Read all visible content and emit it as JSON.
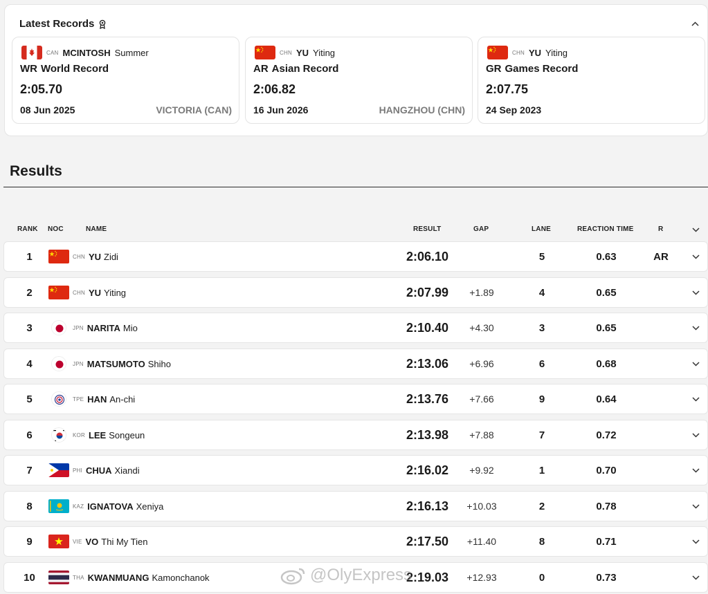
{
  "records": {
    "title": "Latest Records",
    "cards": [
      {
        "noc": "CAN",
        "last": "MCINTOSH",
        "first": "Summer",
        "abbr": "WR",
        "type": "World Record",
        "time": "2:05.70",
        "date": "08 Jun 2025",
        "location": "VICTORIA (CAN)"
      },
      {
        "noc": "CHN",
        "last": "YU",
        "first": "Yiting",
        "abbr": "AR",
        "type": "Asian Record",
        "time": "2:06.82",
        "date": "16 Jun 2026",
        "location": "HANGZHOU (CHN)"
      },
      {
        "noc": "CHN",
        "last": "YU",
        "first": "Yiting",
        "abbr": "GR",
        "type": "Games Record",
        "time": "2:07.75",
        "date": "24 Sep 2023",
        "location": ""
      }
    ]
  },
  "results": {
    "heading": "Results",
    "columns": {
      "rank": "RANK",
      "noc": "NOC",
      "name": "NAME",
      "result": "RESULT",
      "gap": "GAP",
      "lane": "LANE",
      "reaction": "REACTION TIME",
      "r": "R"
    },
    "rows": [
      {
        "rank": "1",
        "noc": "CHN",
        "last": "YU",
        "first": "Zidi",
        "result": "2:06.10",
        "gap": "",
        "lane": "5",
        "reaction": "0.63",
        "r": "AR",
        "flag": "chn"
      },
      {
        "rank": "2",
        "noc": "CHN",
        "last": "YU",
        "first": "Yiting",
        "result": "2:07.99",
        "gap": "+1.89",
        "lane": "4",
        "reaction": "0.65",
        "r": "",
        "flag": "chn"
      },
      {
        "rank": "3",
        "noc": "JPN",
        "last": "NARITA",
        "first": "Mio",
        "result": "2:10.40",
        "gap": "+4.30",
        "lane": "3",
        "reaction": "0.65",
        "r": "",
        "flag": "jpn"
      },
      {
        "rank": "4",
        "noc": "JPN",
        "last": "MATSUMOTO",
        "first": "Shiho",
        "result": "2:13.06",
        "gap": "+6.96",
        "lane": "6",
        "reaction": "0.68",
        "r": "",
        "flag": "jpn"
      },
      {
        "rank": "5",
        "noc": "TPE",
        "last": "HAN",
        "first": "An-chi",
        "result": "2:13.76",
        "gap": "+7.66",
        "lane": "9",
        "reaction": "0.64",
        "r": "",
        "flag": "tpe"
      },
      {
        "rank": "6",
        "noc": "KOR",
        "last": "LEE",
        "first": "Songeun",
        "result": "2:13.98",
        "gap": "+7.88",
        "lane": "7",
        "reaction": "0.72",
        "r": "",
        "flag": "kor"
      },
      {
        "rank": "7",
        "noc": "PHI",
        "last": "CHUA",
        "first": "Xiandi",
        "result": "2:16.02",
        "gap": "+9.92",
        "lane": "1",
        "reaction": "0.70",
        "r": "",
        "flag": "phi"
      },
      {
        "rank": "8",
        "noc": "KAZ",
        "last": "IGNATOVA",
        "first": "Xeniya",
        "result": "2:16.13",
        "gap": "+10.03",
        "lane": "2",
        "reaction": "0.78",
        "r": "",
        "flag": "kaz"
      },
      {
        "rank": "9",
        "noc": "VIE",
        "last": "VO",
        "first": "Thi My Tien",
        "result": "2:17.50",
        "gap": "+11.40",
        "lane": "8",
        "reaction": "0.71",
        "r": "",
        "flag": "vie"
      },
      {
        "rank": "10",
        "noc": "THA",
        "last": "KWANMUANG",
        "first": "Kamonchanok",
        "result": "2:19.03",
        "gap": "+12.93",
        "lane": "0",
        "reaction": "0.73",
        "r": "",
        "flag": "tha"
      }
    ]
  },
  "watermark": {
    "text": "@OlyExpress"
  }
}
